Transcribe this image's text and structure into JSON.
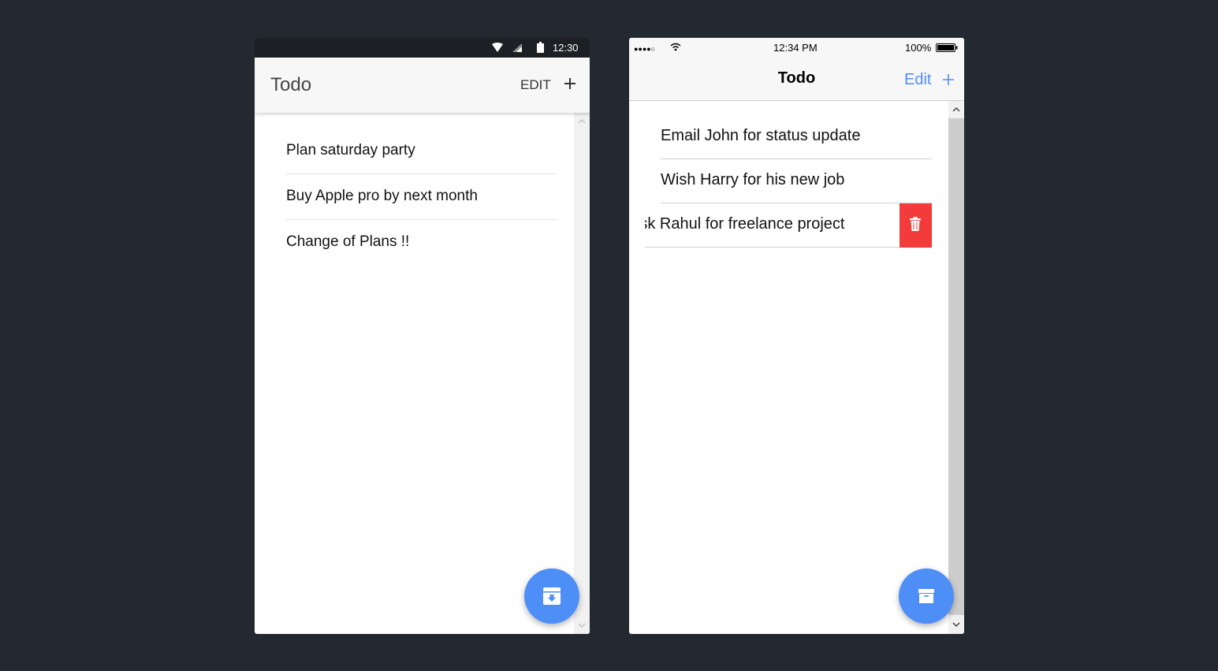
{
  "android": {
    "status_time": "12:30",
    "title": "Todo",
    "edit_label": "EDIT",
    "items": [
      {
        "label": "Plan saturday party"
      },
      {
        "label": "Buy Apple pro by next month"
      },
      {
        "label": "Change of Plans !!"
      }
    ],
    "fab_icon": "archive-download-icon",
    "colors": {
      "status_bar": "#1c1f24",
      "toolbar": "#f7f7f7",
      "fab": "#4e8ef7"
    }
  },
  "ios": {
    "signal": "●●●●○",
    "status_time": "12:34 PM",
    "battery": "100%",
    "title": "Todo",
    "edit_label": "Edit",
    "items": [
      {
        "label": "Email John for status update"
      },
      {
        "label": "Wish Harry for his new job"
      },
      {
        "label": "Ask Rahul for freelance project"
      }
    ],
    "delete_icon": "trash-icon",
    "fab_icon": "archive-box-icon",
    "colors": {
      "accent": "#4e8ef7",
      "delete": "#f33b3b",
      "nav": "#f7f7f7"
    }
  }
}
